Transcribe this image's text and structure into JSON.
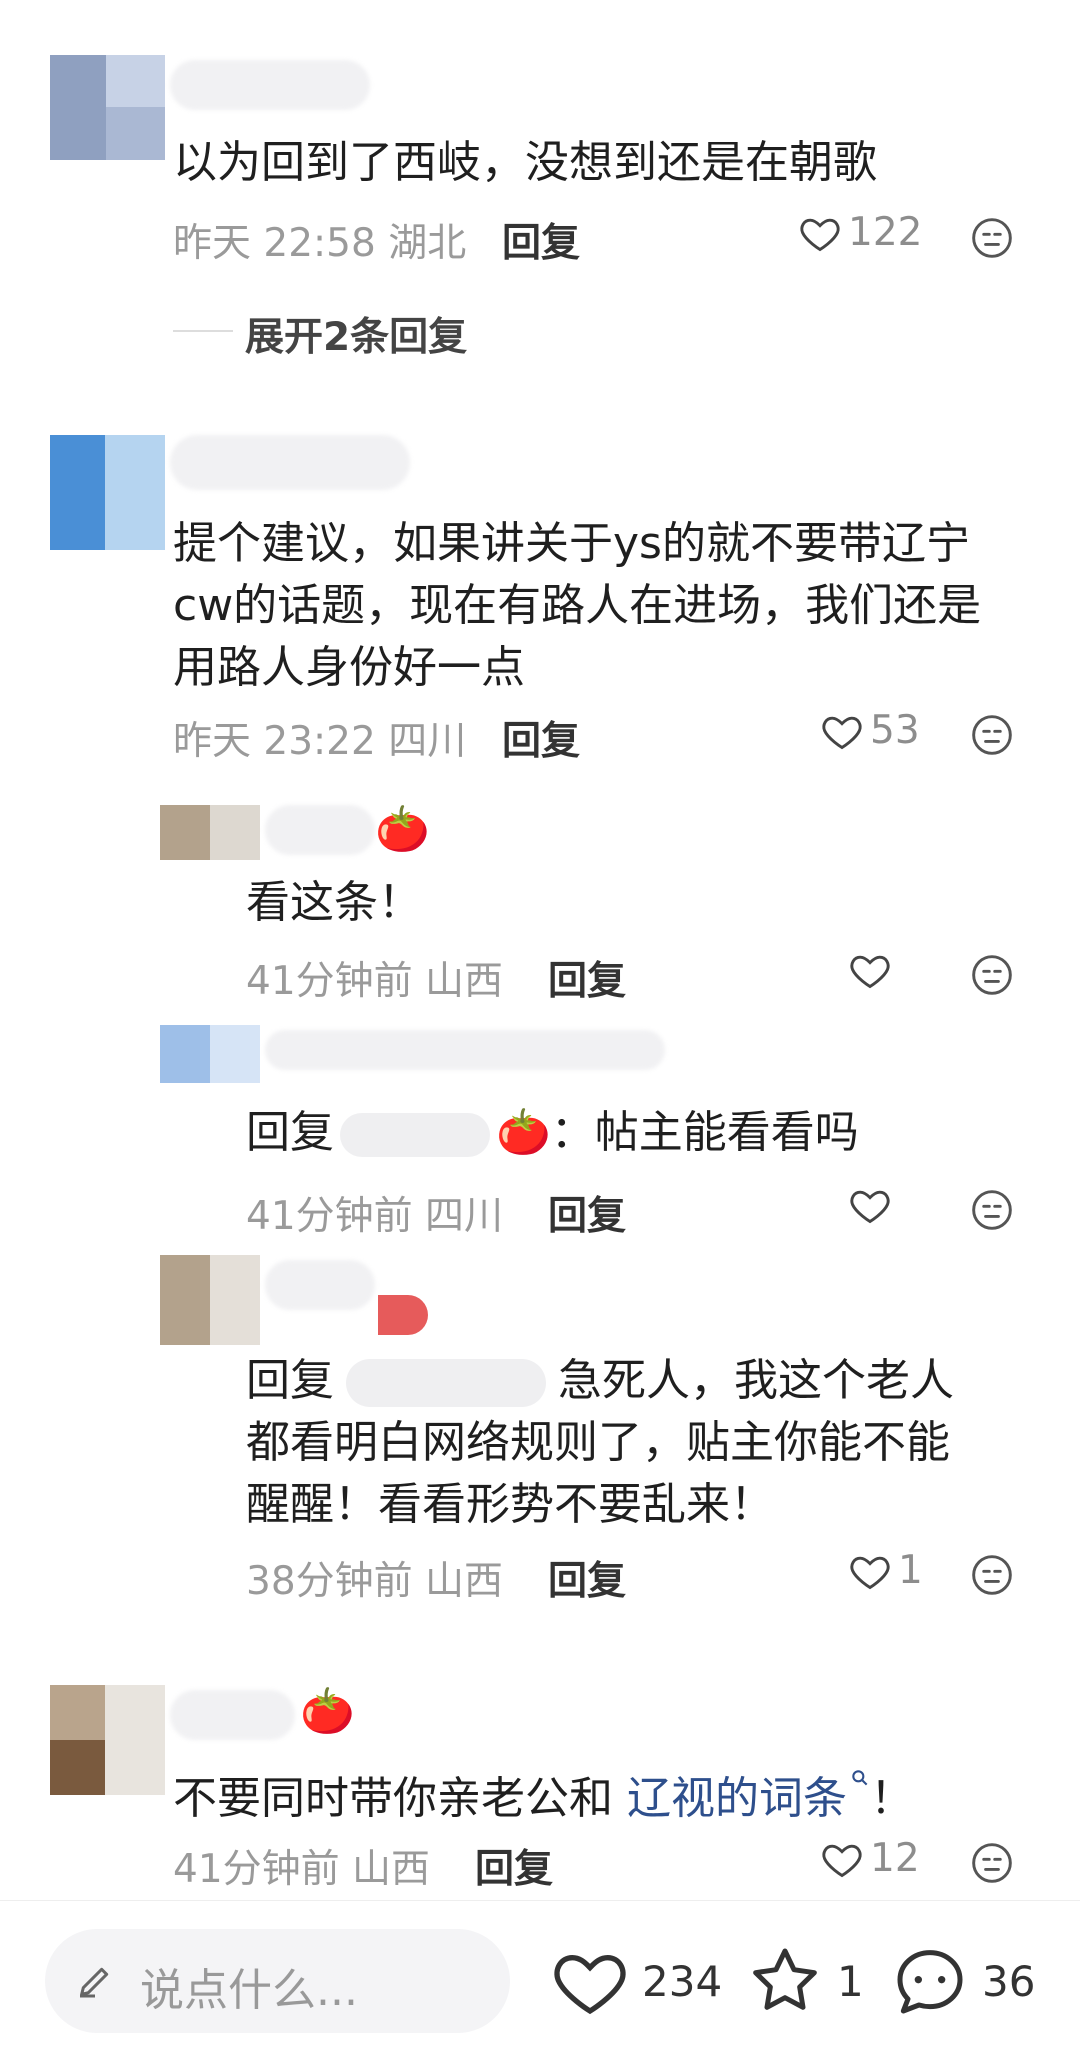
{
  "comments": [
    {
      "text": "以为回到了西岐，没想到还是在朝歌",
      "time": "昨天 22:58",
      "location": "湖北",
      "reply_label": "回复",
      "likes": "122",
      "expand_label": "展开2条回复"
    },
    {
      "text_lines": [
        "提个建议，如果讲关于ys的就不要带辽宁",
        "cw的话题，现在有路人在进场，我们还是",
        "用路人身份好一点"
      ],
      "time": "昨天 23:22",
      "location": "四川",
      "reply_label": "回复",
      "likes": "53",
      "replies": [
        {
          "text": "看这条！",
          "time": "41分钟前",
          "location": "山西",
          "reply_label": "回复",
          "likes": ""
        },
        {
          "prefix": "回复",
          "text": "：帖主能看看吗",
          "time": "41分钟前",
          "location": "四川",
          "reply_label": "回复",
          "likes": ""
        },
        {
          "prefix": "回复",
          "text_lines": [
            "急死人，我这个老人",
            "都看明白网络规则了，贴主你能不能",
            "醒醒！看看形势不要乱来！"
          ],
          "time": "38分钟前",
          "location": "山西",
          "reply_label": "回复",
          "likes": "1"
        }
      ]
    },
    {
      "text": "不要同时带你亲老公和",
      "link_text": "辽视的词条",
      "text_end": "！",
      "time": "41分钟前",
      "location": "山西",
      "reply_label": "回复",
      "likes": "12"
    }
  ],
  "bottom_bar": {
    "input_placeholder": "说点什么...",
    "likes": "234",
    "favorites": "1",
    "comments": "36"
  },
  "icons": [
    "heart-icon",
    "face-icon",
    "pencil-icon",
    "star-icon",
    "chat-icon",
    "tomato-emoji",
    "search-icon"
  ]
}
